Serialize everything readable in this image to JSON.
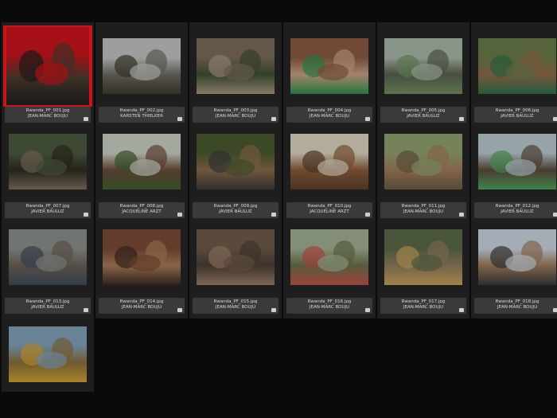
{
  "library": {
    "items": [
      {
        "file": "Rwanda_PF_001.jpg",
        "author": "JEAN-MARC BOUJU",
        "colors": [
          "#c8141a",
          "#4b3b2e",
          "#1f1f1f"
        ],
        "selected": true
      },
      {
        "file": "Rwanda_PF_002.jpg",
        "author": "KARSTEN THIELKER",
        "colors": [
          "#bfc3c0",
          "#6d6a5f",
          "#3f3a2f"
        ]
      },
      {
        "file": "Rwanda_PF_003.jpg",
        "author": "JEAN-MARC BOUJU",
        "colors": [
          "#7a6a58",
          "#3e4f33",
          "#a99680"
        ]
      },
      {
        "file": "Rwanda_PF_004.jpg",
        "author": "JEAN-MARC BOUJU",
        "colors": [
          "#8a5a43",
          "#c7a183",
          "#2f8f4e"
        ]
      },
      {
        "file": "Rwanda_PF_005.jpg",
        "author": "JAVIER BAULUZ",
        "colors": [
          "#a7b6a6",
          "#59604f",
          "#6f8f5f"
        ]
      },
      {
        "file": "Rwanda_PF_006.jpg",
        "author": "JAVIER BAULUZ",
        "colors": [
          "#6a7a4a",
          "#8f6a4a",
          "#2f6f4a"
        ]
      },
      {
        "file": "Rwanda_PF_007.jpg",
        "author": "JAVIER BAULUZ",
        "colors": [
          "#4b5a3f",
          "#2f2a20",
          "#7a6f5a"
        ]
      },
      {
        "file": "Rwanda_PF_008.jpg",
        "author": "JACQUELINE ARZT",
        "colors": [
          "#c9cfc4",
          "#6a4a3a",
          "#3f5f2f"
        ]
      },
      {
        "file": "Rwanda_PF_009.jpg",
        "author": "JAVIER BAULUZ",
        "colors": [
          "#4a5a2f",
          "#8a6a4a",
          "#3a3a3a"
        ]
      },
      {
        "file": "Rwanda_PF_010.jpg",
        "author": "JACQUELINE ARZT",
        "colors": [
          "#d9d2bf",
          "#8a5a3a",
          "#5a3f2a"
        ]
      },
      {
        "file": "Rwanda_PF_011.jpg",
        "author": "JEAN-MARC BOUJU",
        "colors": [
          "#8fa06f",
          "#a07a5a",
          "#6a5a45"
        ]
      },
      {
        "file": "Rwanda_PF_012.jpg",
        "author": "JAVIER BAULUZ",
        "colors": [
          "#b7c7cf",
          "#5a4a3a",
          "#4fa05a"
        ]
      },
      {
        "file": "Rwanda_PF_013.jpg",
        "author": "JAVIER BAULUZ",
        "colors": [
          "#8a8f8a",
          "#6a5f55",
          "#3f4a5a"
        ]
      },
      {
        "file": "Rwanda_PF_014.jpg",
        "author": "JEAN-MARC BOUJU",
        "colors": [
          "#7a4a35",
          "#a87a5a",
          "#3a2a20"
        ]
      },
      {
        "file": "Rwanda_PF_015.jpg",
        "author": "JEAN-MARC BOUJU",
        "colors": [
          "#6f5a4a",
          "#4a3f35",
          "#9a7f6a"
        ]
      },
      {
        "file": "Rwanda_PF_016.jpg",
        "author": "JEAN-MARC BOUJU",
        "colors": [
          "#9fae8f",
          "#6a6f4a",
          "#c0504a"
        ]
      },
      {
        "file": "Rwanda_PF_017.jpg",
        "author": "JEAN-MARC BOUJU",
        "colors": [
          "#5a6a4a",
          "#8f7a5a",
          "#c4a05a"
        ]
      },
      {
        "file": "Rwanda_PF_018.jpg",
        "author": "JEAN-MARC BOUJU",
        "colors": [
          "#c9d4df",
          "#9a7a5a",
          "#3a3a3a"
        ]
      },
      {
        "file": "",
        "author": "",
        "colors": [
          "#7f9fb8",
          "#8a6f3a",
          "#d0a030"
        ]
      }
    ]
  }
}
